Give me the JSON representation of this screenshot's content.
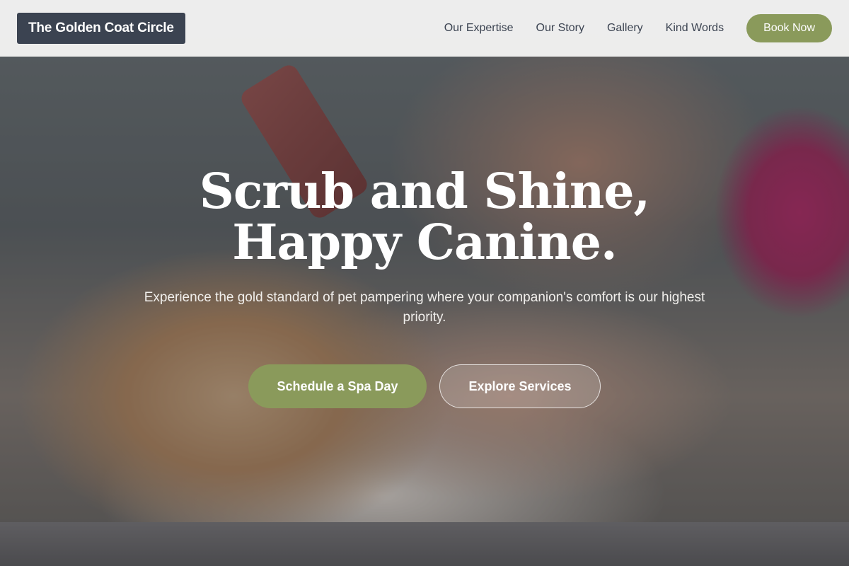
{
  "header": {
    "brand": "The Golden Coat Circle",
    "nav": [
      "Our Expertise",
      "Our Story",
      "Gallery",
      "Kind Words"
    ],
    "cta": "Book Now"
  },
  "hero": {
    "title_line1": "Scrub and Shine,",
    "title_line2": "Happy Canine.",
    "subtitle": "Experience the gold standard of pet pampering where your companion's comfort is our highest priority.",
    "primary_button": "Schedule a Spa Day",
    "secondary_button": "Explore Services",
    "image": "cat-being-groomed-photo"
  },
  "colors": {
    "accent": "#8a9a5b",
    "brand_bg": "#3b4351",
    "header_bg": "#f4f4f3"
  }
}
